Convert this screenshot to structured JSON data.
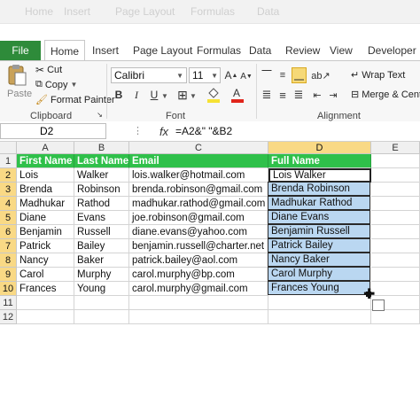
{
  "ribbon_tabs": [
    "File",
    "Home",
    "Insert",
    "Page Layout",
    "Formulas",
    "Data",
    "Review",
    "View",
    "Developer"
  ],
  "clipboard": {
    "cut": "Cut",
    "copy": "Copy",
    "format_painter": "Format Painter",
    "paste": "Paste",
    "label": "Clipboard"
  },
  "font": {
    "name": "Calibri",
    "size": "11",
    "label": "Font"
  },
  "alignment": {
    "wrap_text": "Wrap Text",
    "merge": "Merge & Cente",
    "label": "Alignment"
  },
  "formula_bar": {
    "name_box": "D2",
    "fx": "fx",
    "formula": "=A2&\" \"&B2"
  },
  "columns": [
    "A",
    "B",
    "C",
    "D",
    "E"
  ],
  "rows": [
    "1",
    "2",
    "3",
    "4",
    "5",
    "6",
    "7",
    "8",
    "9",
    "10",
    "11",
    "12"
  ],
  "table": {
    "headers": [
      "First Name",
      "Last Name",
      "Email",
      "Full Name"
    ],
    "rows": [
      [
        "Lois",
        "Walker",
        "lois.walker@hotmail.com",
        "Lois Walker"
      ],
      [
        "Brenda",
        "Robinson",
        "brenda.robinson@gmail.com",
        "Brenda Robinson"
      ],
      [
        "Madhukar",
        "Rathod",
        "madhukar.rathod@gmail.com",
        "Madhukar Rathod"
      ],
      [
        "Diane",
        "Evans",
        "joe.robinson@gmail.com",
        "Diane Evans"
      ],
      [
        "Benjamin",
        "Russell",
        "diane.evans@yahoo.com",
        "Benjamin Russell"
      ],
      [
        "Patrick",
        "Bailey",
        "benjamin.russell@charter.net",
        "Patrick Bailey"
      ],
      [
        "Nancy",
        "Baker",
        "patrick.bailey@aol.com",
        "Nancy Baker"
      ],
      [
        "Carol",
        "Murphy",
        "carol.murphy@bp.com",
        "Carol Murphy"
      ],
      [
        "Frances",
        "Young",
        "carol.murphy@gmail.com",
        "Frances Young"
      ]
    ]
  },
  "colors": {
    "header_green": "#2fc04a",
    "selection_blue": "#bad7f1",
    "file_tab": "#2e8b3a"
  }
}
